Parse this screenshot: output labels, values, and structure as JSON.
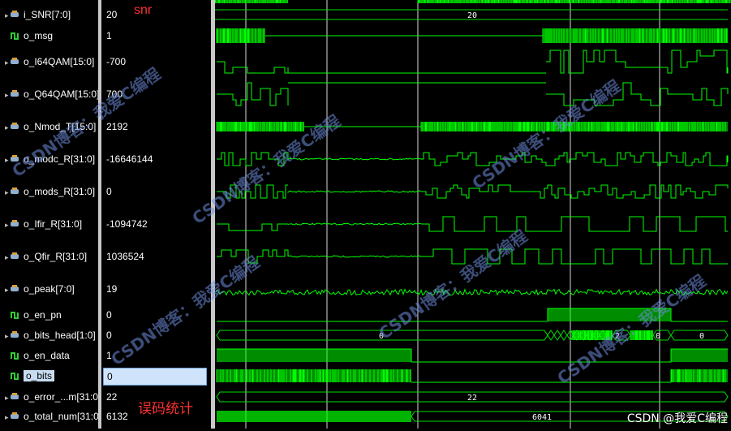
{
  "signals": [
    {
      "name": "i_SNR[7:0]",
      "value": "20",
      "icon": "bus-icon",
      "expandable": true
    },
    {
      "name": "o_msg",
      "value": "1",
      "icon": "bit-icon",
      "expandable": false
    },
    {
      "name": "o_I64QAM[15:0]",
      "value": "-700",
      "icon": "bus-icon",
      "expandable": true
    },
    {
      "name": "o_Q64QAM[15:0]",
      "value": "700",
      "icon": "bus-icon",
      "expandable": true
    },
    {
      "name": "o_Nmod_T[15:0]",
      "value": "2192",
      "icon": "bus-icon",
      "expandable": true
    },
    {
      "name": "o_modc_R[31:0]",
      "value": "-16646144",
      "icon": "bus-icon",
      "expandable": true
    },
    {
      "name": "o_mods_R[31:0]",
      "value": "0",
      "icon": "bus-icon",
      "expandable": true
    },
    {
      "name": "o_Ifir_R[31:0]",
      "value": "-1094742",
      "icon": "bus-icon",
      "expandable": true
    },
    {
      "name": "o_Qfir_R[31:0]",
      "value": "1036524",
      "icon": "bus-icon",
      "expandable": true
    },
    {
      "name": "o_peak[7:0]",
      "value": "19",
      "icon": "bus-icon",
      "expandable": true
    },
    {
      "name": "o_en_pn",
      "value": "0",
      "icon": "bit-icon",
      "expandable": false
    },
    {
      "name": "o_bits_head[1:0]",
      "value": "0",
      "icon": "bus-icon",
      "expandable": true
    },
    {
      "name": "o_en_data",
      "value": "1",
      "icon": "bit-icon",
      "expandable": false
    },
    {
      "name": "o_bits",
      "value": "0",
      "icon": "bit-icon",
      "expandable": false,
      "selected": true
    },
    {
      "name": "o_error_...m[31:0]",
      "value": "22",
      "icon": "bus-icon",
      "expandable": true
    },
    {
      "name": "o_total_num[31:0]",
      "value": "6132",
      "icon": "bus-icon",
      "expandable": true
    }
  ],
  "bus_labels": {
    "snr": "20",
    "bits_head_a": "0",
    "bits_head_b": "2",
    "bits_head_c": "0",
    "bits_head_d": "0",
    "error": "22",
    "total": "6041"
  },
  "annotations": {
    "snr": "snr",
    "error_stats": "误码统计"
  },
  "watermark": "CSDN博客：我爱C编程",
  "footer_credit": "CSDN @我爱C编程",
  "colors": {
    "waveform": "#00ff00",
    "bus_line": "#00e000",
    "cursor": "#ffffff",
    "annotation": "#ff3030"
  }
}
